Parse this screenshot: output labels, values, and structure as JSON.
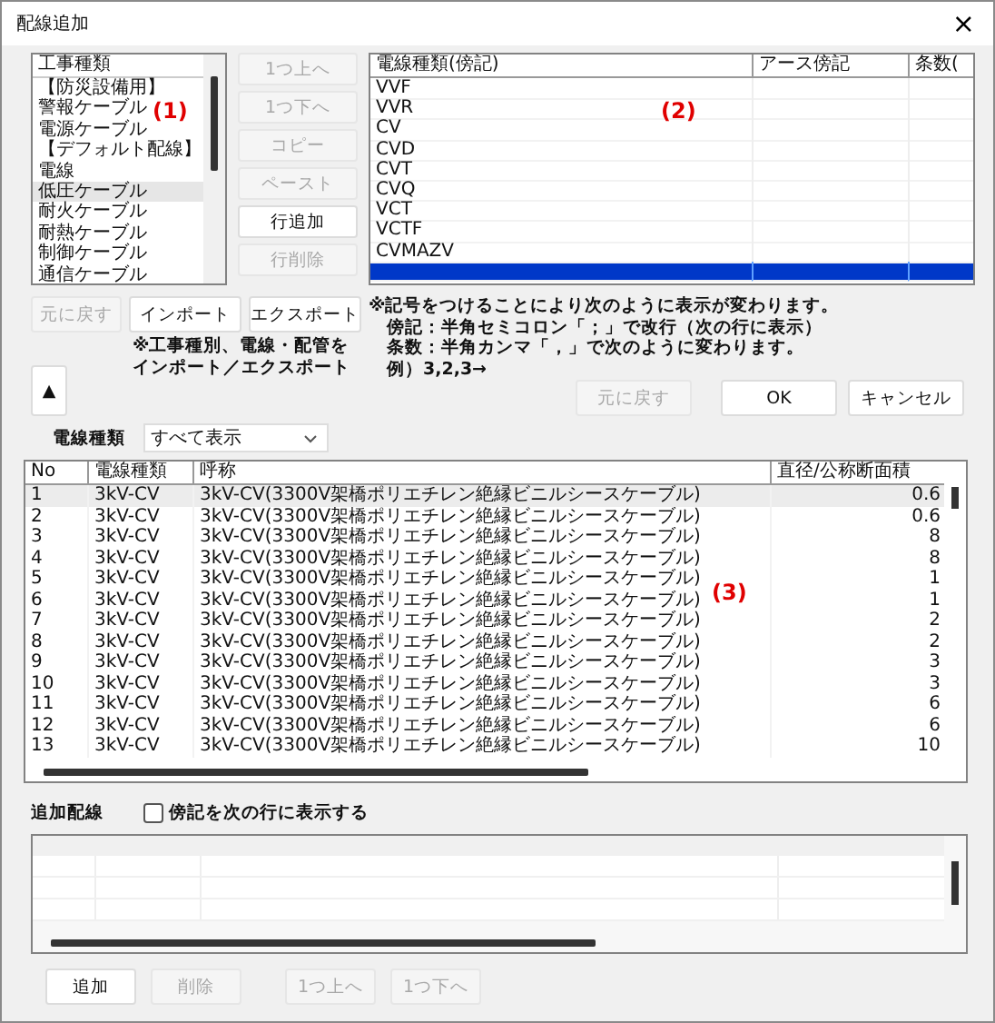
{
  "window": {
    "title": "配線追加",
    "close": "×"
  },
  "construction_list": {
    "annotation": "(1)",
    "header": "工事種類",
    "items": [
      {
        "label": "【防災設備用】",
        "selected": false
      },
      {
        "label": "警報ケーブル",
        "selected": false
      },
      {
        "label": "電源ケーブル",
        "selected": false
      },
      {
        "label": "【デフォルト配線】",
        "selected": false
      },
      {
        "label": "電線",
        "selected": false
      },
      {
        "label": "低圧ケーブル",
        "selected": true
      },
      {
        "label": "耐火ケーブル",
        "selected": false
      },
      {
        "label": "耐熱ケーブル",
        "selected": false
      },
      {
        "label": "制御ケーブル",
        "selected": false
      },
      {
        "label": "通信ケーブル",
        "selected": false
      }
    ]
  },
  "row_buttons": [
    {
      "label": "1つ上へ",
      "disabled": true
    },
    {
      "label": "1つ下へ",
      "disabled": true
    },
    {
      "label": "コピー",
      "disabled": true
    },
    {
      "label": "ペースト",
      "disabled": true
    },
    {
      "label": "行追加",
      "disabled": false
    },
    {
      "label": "行削除",
      "disabled": true
    }
  ],
  "wire_list": {
    "annotation": "(2)",
    "columns": [
      "電線種類(傍記)",
      "アース傍記",
      "条数("
    ],
    "rows": [
      {
        "name": "VVF",
        "selected": false
      },
      {
        "name": "VVR",
        "selected": false
      },
      {
        "name": "CV",
        "selected": false
      },
      {
        "name": "CVD",
        "selected": false
      },
      {
        "name": "CVT",
        "selected": false
      },
      {
        "name": "CVQ",
        "selected": false
      },
      {
        "name": "VCT",
        "selected": false
      },
      {
        "name": "VCTF",
        "selected": false
      },
      {
        "name": "CVMAZV",
        "selected": false
      },
      {
        "selected": true
      }
    ]
  },
  "undo_button": {
    "label": "元に戻す",
    "disabled": true
  },
  "import_buttons": [
    {
      "label": "インポート",
      "disabled": false
    },
    {
      "label": "エクスポート",
      "disabled": false
    }
  ],
  "import_note": [
    "※工事種別、電線・配管を",
    "インポート／エクスポート"
  ],
  "symbol_note": [
    "※記号をつけることにより次のように表示が変わります。",
    "傍記：半角セミコロン「；」で改行（次の行に表示）",
    "条数：半角カンマ「，」で次のように変わります。",
    "例）3,2,3→"
  ],
  "collapse_button": "▲",
  "dialog_buttons": [
    {
      "label": "元に戻す",
      "disabled": true
    },
    {
      "label": "OK",
      "disabled": false
    },
    {
      "label": "キャンセル",
      "disabled": false
    }
  ],
  "filter": {
    "label": "電線種類",
    "value": "すべて表示"
  },
  "cable_table": {
    "annotation": "(3)",
    "columns": [
      "No",
      "電線種類",
      "呼称",
      "直径/公称断面積"
    ],
    "rows": [
      {
        "cells": [
          "1",
          "3kV-CV",
          "3kV-CV(3300V架橋ポリエチレン絶縁ビニルシースケーブル)",
          "0.6"
        ],
        "selected": true
      },
      {
        "cells": [
          "2",
          "3kV-CV",
          "3kV-CV(3300V架橋ポリエチレン絶縁ビニルシースケーブル)",
          "0.6"
        ],
        "selected": false
      },
      {
        "cells": [
          "3",
          "3kV-CV",
          "3kV-CV(3300V架橋ポリエチレン絶縁ビニルシースケーブル)",
          "8"
        ],
        "selected": false
      },
      {
        "cells": [
          "4",
          "3kV-CV",
          "3kV-CV(3300V架橋ポリエチレン絶縁ビニルシースケーブル)",
          "8"
        ],
        "selected": false
      },
      {
        "cells": [
          "5",
          "3kV-CV",
          "3kV-CV(3300V架橋ポリエチレン絶縁ビニルシースケーブル)",
          "1"
        ],
        "selected": false
      },
      {
        "cells": [
          "6",
          "3kV-CV",
          "3kV-CV(3300V架橋ポリエチレン絶縁ビニルシースケーブル)",
          "1"
        ],
        "selected": false
      },
      {
        "cells": [
          "7",
          "3kV-CV",
          "3kV-CV(3300V架橋ポリエチレン絶縁ビニルシースケーブル)",
          "2"
        ],
        "selected": false
      },
      {
        "cells": [
          "8",
          "3kV-CV",
          "3kV-CV(3300V架橋ポリエチレン絶縁ビニルシースケーブル)",
          "2"
        ],
        "selected": false
      },
      {
        "cells": [
          "9",
          "3kV-CV",
          "3kV-CV(3300V架橋ポリエチレン絶縁ビニルシースケーブル)",
          "3"
        ],
        "selected": false
      },
      {
        "cells": [
          "10",
          "3kV-CV",
          "3kV-CV(3300V架橋ポリエチレン絶縁ビニルシースケーブル)",
          "3"
        ],
        "selected": false
      },
      {
        "cells": [
          "11",
          "3kV-CV",
          "3kV-CV(3300V架橋ポリエチレン絶縁ビニルシースケーブル)",
          "6"
        ],
        "selected": false
      },
      {
        "cells": [
          "12",
          "3kV-CV",
          "3kV-CV(3300V架橋ポリエチレン絶縁ビニルシースケーブル)",
          "6"
        ],
        "selected": false
      },
      {
        "cells": [
          "13",
          "3kV-CV",
          "3kV-CV(3300V架橋ポリエチレン絶縁ビニルシースケーブル)",
          "10"
        ],
        "selected": false
      }
    ]
  },
  "added_wiring": {
    "label": "追加配線",
    "checkbox": {
      "label": "傍記を次の行に表示する",
      "checked": false
    }
  },
  "bottom_buttons": [
    {
      "label": "追加",
      "disabled": false
    },
    {
      "label": "削除",
      "disabled": true
    },
    {
      "label": "1つ上へ",
      "disabled": true
    },
    {
      "label": "1つ下へ",
      "disabled": true
    }
  ]
}
